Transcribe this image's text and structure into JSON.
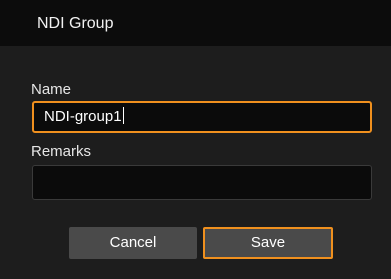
{
  "dialog": {
    "title": "NDI Group"
  },
  "form": {
    "name_label": "Name",
    "name_value": "NDI-group1",
    "remarks_label": "Remarks",
    "remarks_value": ""
  },
  "buttons": {
    "cancel_label": "Cancel",
    "save_label": "Save"
  },
  "colors": {
    "accent": "#f0901e",
    "titlebar": "#0c0c0c",
    "body": "#1d1d1d",
    "button": "#4a4a4a"
  }
}
